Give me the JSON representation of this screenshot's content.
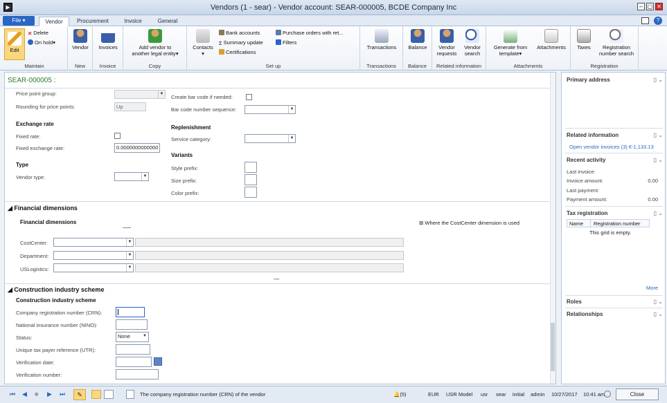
{
  "window": {
    "title": "Vendors (1 - sear) - Vendor account: SEAR-000005, BCDE Company Inc"
  },
  "tabs": {
    "file": "File",
    "items": [
      "Vendor",
      "Procurement",
      "Invoice",
      "General"
    ]
  },
  "ribbon": {
    "maintain": {
      "edit": "Edit",
      "delete": "Delete",
      "on_hold": "On hold",
      "group": "Maintain"
    },
    "new": {
      "vendor": "Vendor",
      "group": "New"
    },
    "invoice": {
      "invoices": "Invoices",
      "group": "Invoice"
    },
    "copy": {
      "add_vendor_1": "Add vendor to",
      "add_vendor_2": "another legal entity",
      "group": "Copy"
    },
    "setup": {
      "contacts": "Contacts",
      "bank_accounts": "Bank accounts",
      "summary_update": "Summary update",
      "certifications": "Certifications",
      "purchase_orders": "Purchase orders with ret...",
      "filters": "Filters",
      "group": "Set up"
    },
    "transactions": {
      "transactions": "Transactions",
      "group": "Transactions"
    },
    "balance": {
      "balance": "Balance",
      "group": "Balance"
    },
    "related": {
      "vendor_requests_1": "Vendor",
      "vendor_requests_2": "requests",
      "vendor_search_1": "Vendor",
      "vendor_search_2": "search",
      "group": "Related information"
    },
    "attachments": {
      "generate_1": "Generate from",
      "generate_2": "template",
      "attachments": "Attachments",
      "group": "Attachments"
    },
    "registration": {
      "taxes": "Taxes",
      "regsearch_1": "Registration",
      "regsearch_2": "number search",
      "group": "Registration"
    }
  },
  "record_id": "SEAR-000005 :",
  "form": {
    "price_point_group": "Price point group:",
    "rounding_label": "Rounding for price points:",
    "rounding_value": "Up",
    "create_barcode": "Create bar code if needed:",
    "barcode_seq": "Bar code number sequence:",
    "exchange_rate_hdr": "Exchange rate",
    "fixed_rate": "Fixed rate:",
    "fixed_exchange_rate": "Fixed exchange rate:",
    "fixed_exchange_value": "0.0000000000000",
    "replenishment_hdr": "Replenishment",
    "service_category": "Service category:",
    "type_hdr": "Type",
    "vendor_type": "Vendor type:",
    "variants_hdr": "Variants",
    "style_prefix": "Style prefix:",
    "size_prefix": "Size prefix:",
    "color_prefix": "Color prefix:"
  },
  "financial": {
    "section": "Financial dimensions",
    "subhdr": "Financial dimensions",
    "where_used": "Where the CostCenter dimension is used",
    "dims": [
      "CostCenter:",
      "Department:",
      "USLogistics:"
    ]
  },
  "cis": {
    "section": "Construction industry scheme",
    "subhdr": "Construction industry scheme",
    "crn": "Company registration number (CRN):",
    "nino": "National insurance number (NINO):",
    "status": "Status:",
    "status_value": "None",
    "utr": "Unique tax payer reference (UTR):",
    "verification_date": "Verification date:",
    "verification_number": "Verification number:"
  },
  "factbox": {
    "primary_address": "Primary address",
    "related_information": "Related information",
    "open_invoices": "Open vendor invoices (3) €-1,133.13",
    "recent_activity": "Recent activity",
    "last_invoice": "Last invoice:",
    "invoice_amount": "Invoice amount:",
    "invoice_amount_val": "0.00",
    "last_payment": "Last payment:",
    "payment_amount": "Payment amount:",
    "payment_amount_val": "0.00",
    "tax_registration": "Tax registration",
    "col_name": "Name",
    "col_regnum": "Registration number",
    "empty": "This grid is empty.",
    "more": "More",
    "roles": "Roles",
    "relationships": "Relationships"
  },
  "statusbar": {
    "help": "The company registration number (CRN) of the vendor",
    "alerts": "(5)",
    "currency": "EUR",
    "model": "USR Model",
    "layer": "usr",
    "company": "sear",
    "partition": "initial",
    "user": "admin",
    "date": "10/27/2017",
    "time": "10:41 am",
    "close": "Close"
  },
  "colors": {
    "accent": "#2a66c3",
    "record_id": "#2d7a2d"
  }
}
